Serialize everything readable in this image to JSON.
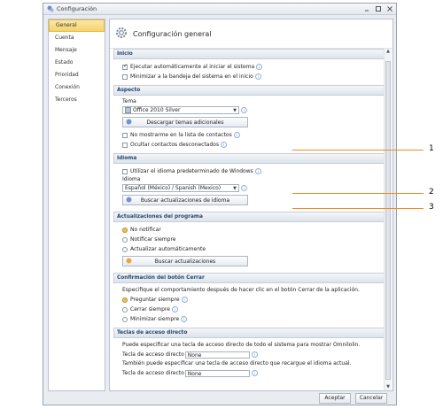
{
  "window": {
    "title": "Configuración"
  },
  "sidebar": {
    "items": [
      {
        "label": "General",
        "selected": true
      },
      {
        "label": "Cuenta"
      },
      {
        "label": "Mensaje"
      },
      {
        "label": "Estado"
      },
      {
        "label": "Prioridad"
      },
      {
        "label": "Conexión"
      },
      {
        "label": "Terceros"
      }
    ]
  },
  "header": {
    "title": "Configuración general"
  },
  "sections": {
    "inicio": {
      "title": "Inicio",
      "auto_start": {
        "label": "Ejecutar automáticamente al iniciar el sistema",
        "checked": true
      },
      "minimize_tray": {
        "label": "Minimizar a la bandeja del sistema en el inicio",
        "checked": false
      }
    },
    "aspecto": {
      "title": "Aspecto",
      "tema_label": "Tema",
      "tema_value": "Office 2010 Silver",
      "download_button": "Descargar temas adicionales",
      "hide_in_contacts": {
        "label": "No mostrarme en la lista de contactos",
        "checked": false
      },
      "hide_offline": {
        "label": "Ocultar contactos desconectados",
        "checked": false
      }
    },
    "idioma": {
      "title": "Idioma",
      "use_windows": {
        "label": "Utilizar el idioma predeterminado de Windows",
        "checked": false
      },
      "idioma_label": "Idioma",
      "idioma_value": "Español (México) / Spanish (Mexico)",
      "update_button": "Buscar actualizaciones de idioma"
    },
    "actualizaciones": {
      "title": "Actualizaciones del programa",
      "options": [
        {
          "label": "No notificar",
          "selected": true
        },
        {
          "label": "Notificar siempre",
          "selected": false
        },
        {
          "label": "Actualizar automáticamente",
          "selected": false
        }
      ],
      "search_button": "Buscar actualizaciones"
    },
    "cerrar": {
      "title": "Confirmación del botón Cerrar",
      "description": "Especifique el comportamiento después de hacer clic en el botón Cerrar de la aplicación.",
      "options": [
        {
          "label": "Preguntar siempre",
          "selected": true
        },
        {
          "label": "Cerrar siempre",
          "selected": false
        },
        {
          "label": "Minimizar siempre",
          "selected": false
        }
      ]
    },
    "teclas": {
      "title": "Teclas de acceso directo",
      "description1": "Puede especificar una tecla de acceso directo de todo el sistema para mostrar Omnilolin.",
      "hotkey1_label": "Tecla de acceso directo",
      "hotkey1_value": "None",
      "description2": "También puede especificar una tecla de acceso directo que recargue el idioma actual.",
      "hotkey2_label": "Tecla de acceso directo",
      "hotkey2_value": "None"
    }
  },
  "footer": {
    "accept": "Aceptar",
    "cancel": "Cancelar"
  },
  "callouts": [
    "1",
    "2",
    "3"
  ],
  "colors": {
    "accent_orange": "#f08a1c",
    "section_header_text": "#24466e",
    "selected_nav": "#f6d36b"
  }
}
